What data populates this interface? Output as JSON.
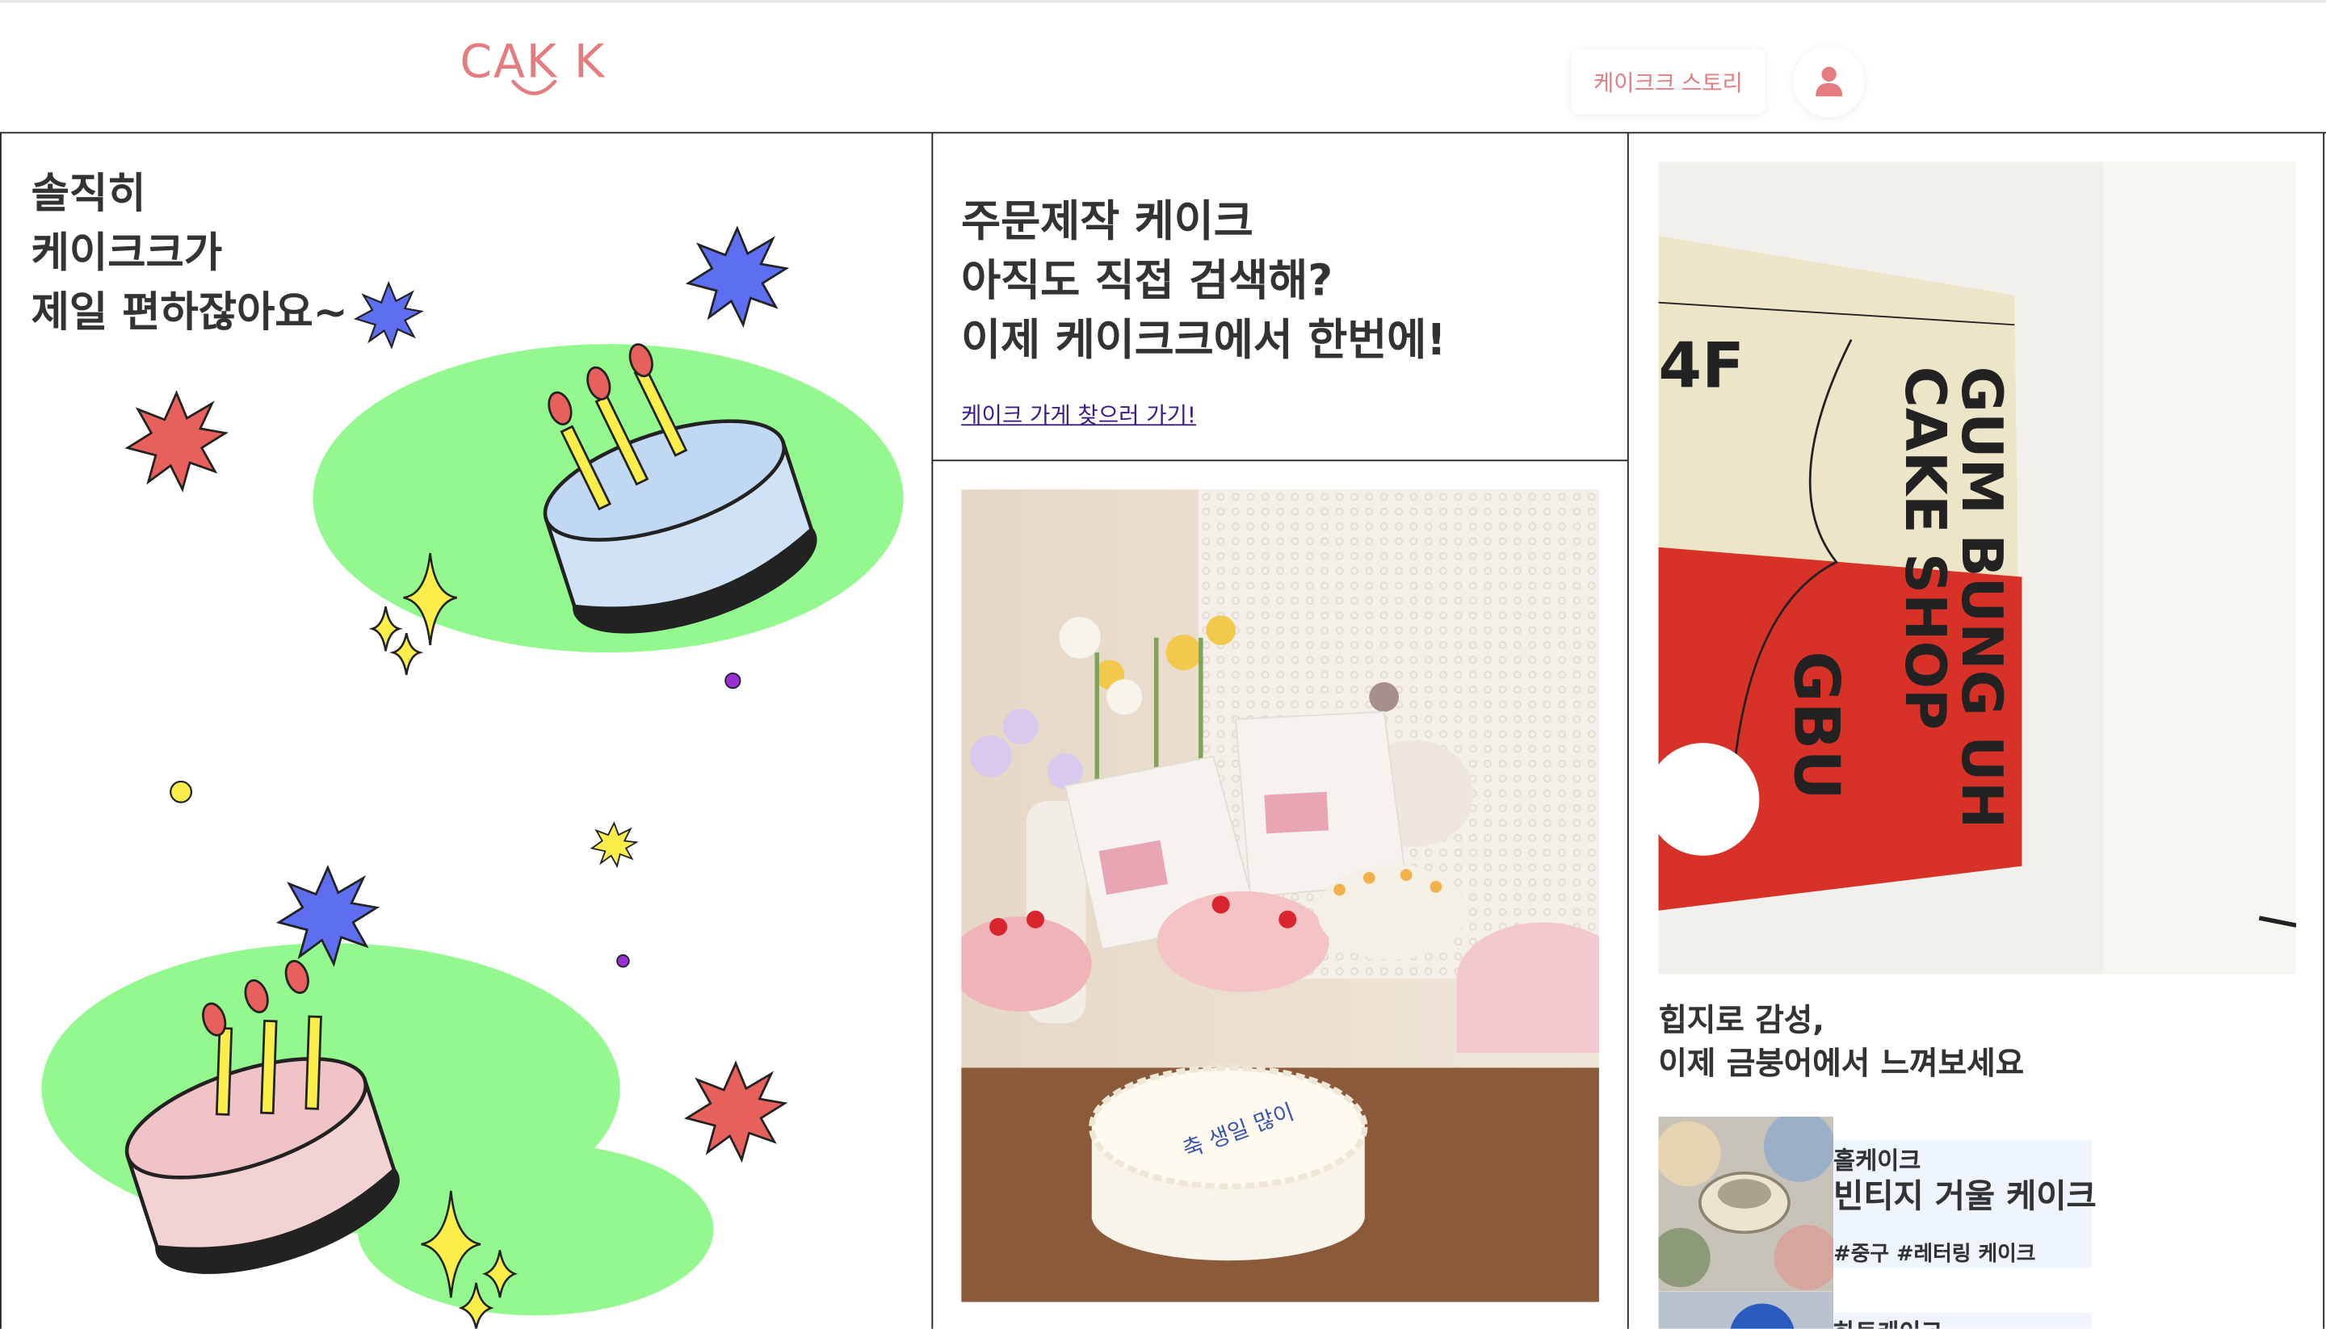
{
  "header": {
    "logo": "CAK K",
    "story_button": "케이크크 스토리",
    "user_icon": "user-icon"
  },
  "hero": {
    "lines": [
      "솔직히",
      "케이크크가",
      "제일 편하잖아요~"
    ]
  },
  "order": {
    "lines": [
      "주문제작 케이크",
      "아직도 직접 검색해?",
      "이제 케이크크에서 한번에!"
    ],
    "link": "케이크 가게 찾으러 가기!"
  },
  "poster": {
    "floor": "4F",
    "title_line1": "GUM BUNG UH",
    "title_line2": "CAKE SHOP",
    "short": "GBU"
  },
  "feature": {
    "lines": [
      "힙지로 감성,",
      "이제 금붕어에서 느껴보세요"
    ]
  },
  "cards": [
    {
      "category": "홀케이크",
      "name": "빈티지 거울 케이크",
      "tags": "#중구 #레터링 케이크"
    },
    {
      "category": "하트케이크"
    }
  ],
  "colors": {
    "brand": "#e47c80",
    "green_blob": "#93f98f",
    "blue_star": "#5d6ef0",
    "red_star": "#e8605c",
    "yellow": "#fbee4a"
  }
}
